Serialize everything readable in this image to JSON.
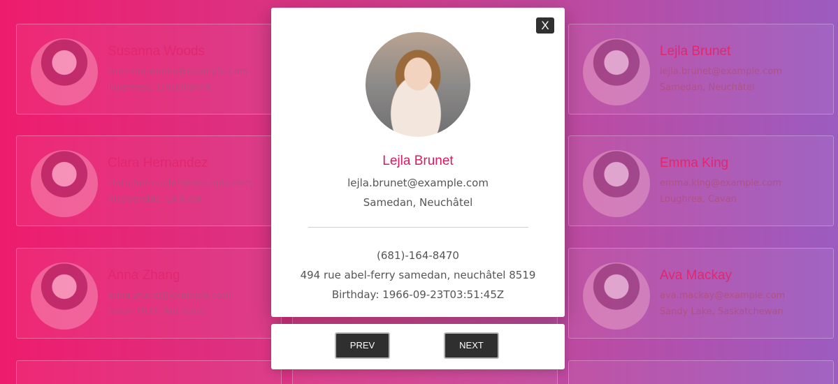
{
  "cards": [
    {
      "name": "Susanna Woods",
      "email": "susanna.woods@example.com",
      "location": "Inverness, Lincolnshire"
    },
    {
      "name": "Clara Hernandez",
      "email": "clara.hernandez@example.com",
      "location": "Alcobendas, La Rioja"
    },
    {
      "name": "Anna Zhang",
      "email": "anna.zhang@example.com",
      "location": "Lower Hutt, Auckland"
    },
    {
      "name": "Lejla Brunet",
      "email": "lejla.brunet@example.com",
      "location": "Samedan, Neuchâtel"
    },
    {
      "name": "Emma King",
      "email": "emma.king@example.com",
      "location": "Loughrea, Cavan"
    },
    {
      "name": "Ava Mackay",
      "email": "ava.mackay@example.com",
      "location": "Sandy Lake, Saskatchewan"
    }
  ],
  "modal": {
    "close_label": "X",
    "name": "Lejla Brunet",
    "email": "lejla.brunet@example.com",
    "location": "Samedan, Neuchâtel",
    "phone": "(681)-164-8470",
    "address": "494 rue abel-ferry samedan, neuchâtel 8519",
    "birthday": "Birthday: 1966-09-23T03:51:45Z"
  },
  "nav": {
    "prev_label": "PREV",
    "next_label": "NEXT"
  }
}
